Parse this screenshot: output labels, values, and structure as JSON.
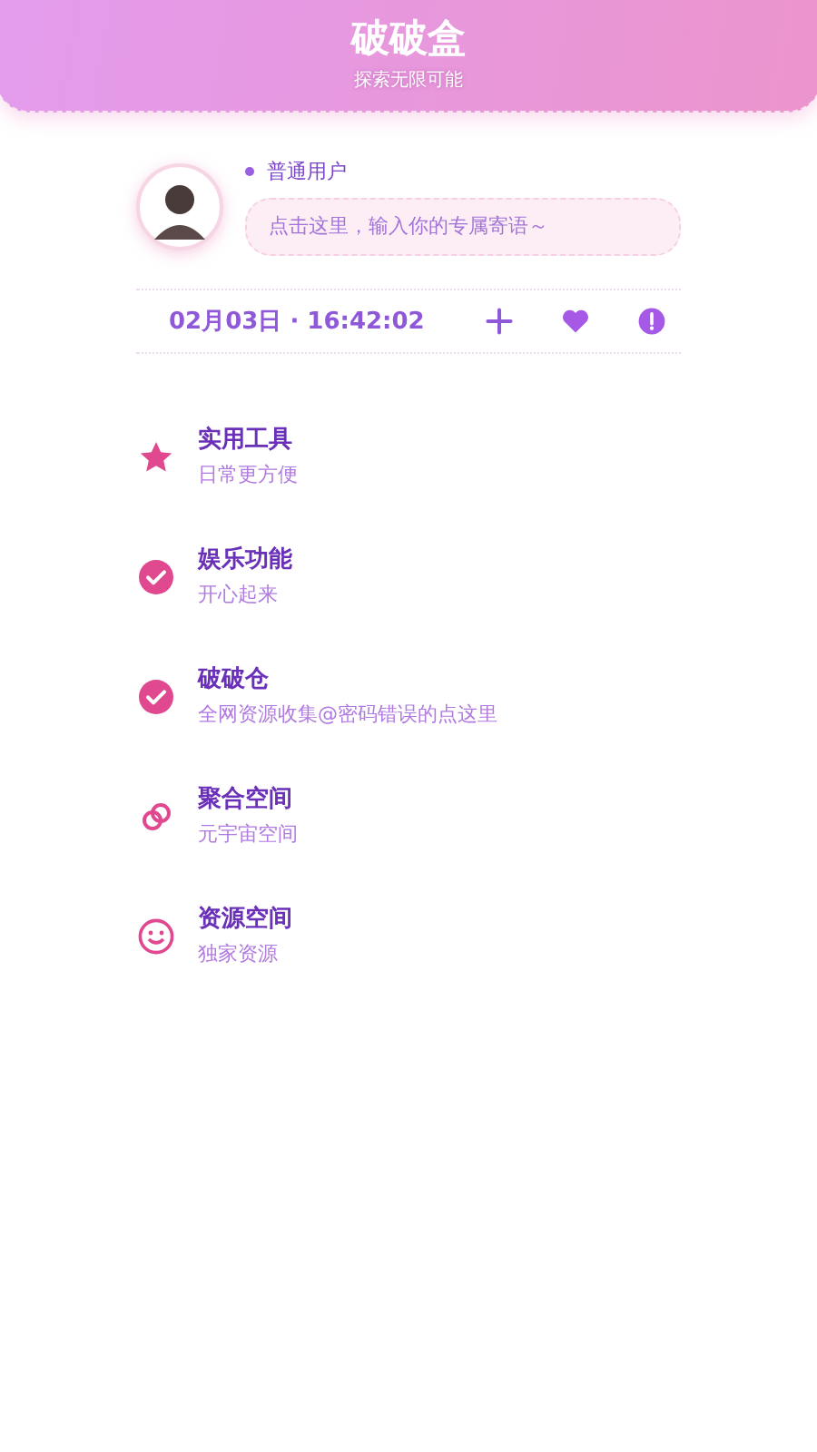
{
  "header": {
    "title": "破破盒",
    "subtitle": "探索无限可能"
  },
  "profile": {
    "user_level": "普通用户",
    "motto_placeholder": "点击这里，输入你的专属寄语～"
  },
  "status_row": {
    "datetime": "02月03日 · 16:42:02",
    "actions": [
      {
        "kind": "add"
      },
      {
        "kind": "heart"
      },
      {
        "kind": "alert"
      }
    ]
  },
  "menu": [
    {
      "kind": "star",
      "title": "实用工具",
      "subtitle": "日常更方便"
    },
    {
      "kind": "check",
      "title": "娱乐功能",
      "subtitle": "开心起来"
    },
    {
      "kind": "check",
      "title": "破破仓",
      "subtitle": "全网资源收集@密码错误的点这里"
    },
    {
      "kind": "link",
      "title": "聚合空间",
      "subtitle": "元宇宙空间"
    },
    {
      "kind": "smile",
      "title": "资源空间",
      "subtitle": "独家资源"
    }
  ]
}
